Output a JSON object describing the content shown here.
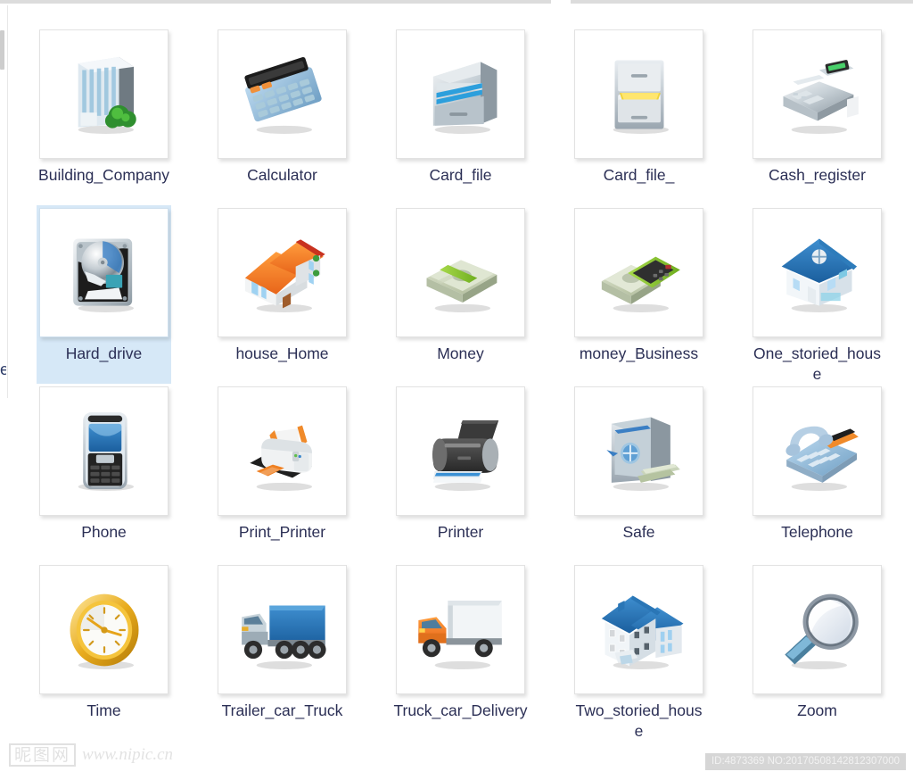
{
  "window": {
    "background_color": "#ffffff",
    "selection_color": "#d6e8f7",
    "label_color": "#2b2f55",
    "left_cut_text": "e"
  },
  "grid": {
    "columns": 5,
    "rows": 4,
    "items": [
      {
        "label": "Building_Company",
        "icon": "office-building-icon",
        "selected": false
      },
      {
        "label": "Calculator",
        "icon": "calculator-icon",
        "selected": false
      },
      {
        "label": "Card_file",
        "icon": "card-file-cabinet-icon",
        "selected": false
      },
      {
        "label": "Card_file_",
        "icon": "file-drawer-icon",
        "selected": false
      },
      {
        "label": "Cash_register",
        "icon": "cash-register-icon",
        "selected": false
      },
      {
        "label": "Hard_drive",
        "icon": "hard-drive-icon",
        "selected": true
      },
      {
        "label": "house_Home",
        "icon": "orange-roof-house-icon",
        "selected": false
      },
      {
        "label": "Money",
        "icon": "money-stack-icon",
        "selected": false
      },
      {
        "label": "money_Business",
        "icon": "money-and-phone-icon",
        "selected": false
      },
      {
        "label": "One_storied_house",
        "icon": "one-storied-house-icon",
        "selected": false
      },
      {
        "label": "Phone",
        "icon": "mobile-phone-icon",
        "selected": false
      },
      {
        "label": "Print_Printer",
        "icon": "office-printer-icon",
        "selected": false
      },
      {
        "label": "Printer",
        "icon": "inkjet-printer-icon",
        "selected": false
      },
      {
        "label": "Safe",
        "icon": "safe-vault-icon",
        "selected": false
      },
      {
        "label": "Telephone",
        "icon": "desk-telephone-icon",
        "selected": false
      },
      {
        "label": "Time",
        "icon": "clock-icon",
        "selected": false
      },
      {
        "label": "Trailer_car_Truck",
        "icon": "semi-trailer-truck-icon",
        "selected": false
      },
      {
        "label": "Truck_car_Delivery",
        "icon": "delivery-truck-icon",
        "selected": false
      },
      {
        "label": "Two_storied_house",
        "icon": "two-storied-house-icon",
        "selected": false
      },
      {
        "label": "Zoom",
        "icon": "magnifier-icon",
        "selected": false
      }
    ]
  },
  "watermark": {
    "logo_text": "昵图网",
    "url_text": "www.nipic.cn"
  },
  "id_badge": {
    "text": "ID:4873369 NO:20170508142812307000"
  }
}
